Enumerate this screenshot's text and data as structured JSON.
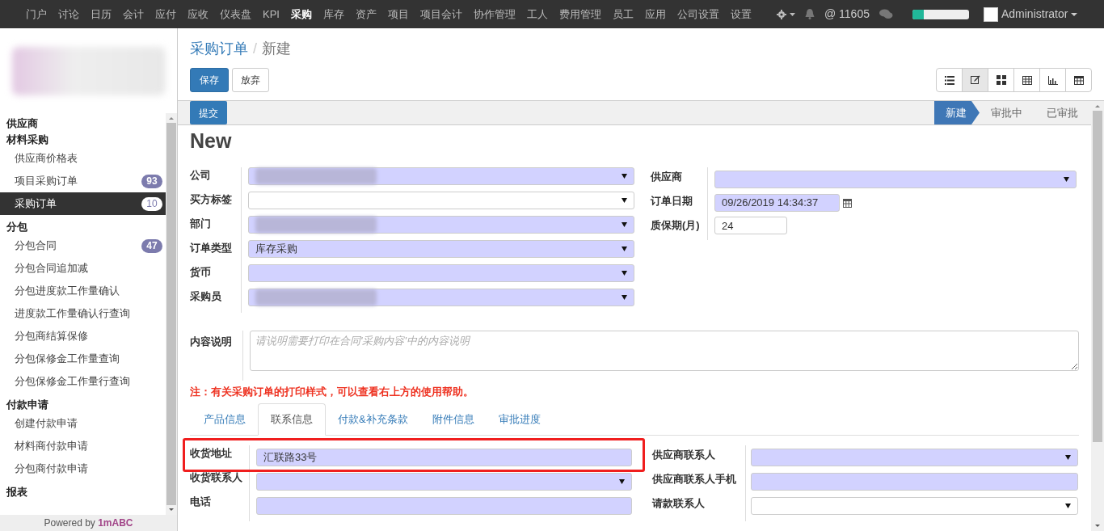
{
  "nav": {
    "items": [
      {
        "label": "门户",
        "selected": false
      },
      {
        "label": "讨论",
        "selected": false
      },
      {
        "label": "日历",
        "selected": false
      },
      {
        "label": "会计",
        "selected": false
      },
      {
        "label": "应付",
        "selected": false
      },
      {
        "label": "应收",
        "selected": false
      },
      {
        "label": "仪表盘",
        "selected": false
      },
      {
        "label": "KPI",
        "selected": false
      },
      {
        "label": "采购",
        "selected": true
      },
      {
        "label": "库存",
        "selected": false
      },
      {
        "label": "资产",
        "selected": false
      },
      {
        "label": "项目",
        "selected": false
      },
      {
        "label": "项目会计",
        "selected": false
      },
      {
        "label": "协作管理",
        "selected": false
      },
      {
        "label": "工人",
        "selected": false
      },
      {
        "label": "费用管理",
        "selected": false
      },
      {
        "label": "员工",
        "selected": false
      },
      {
        "label": "应用",
        "selected": false
      },
      {
        "label": "公司设置",
        "selected": false
      },
      {
        "label": "设置",
        "selected": false
      }
    ],
    "counter": "@ 11605",
    "progress": {
      "level": 0.2
    },
    "user": "Administrator"
  },
  "sidebar": {
    "sections": [
      {
        "title": "供应商"
      },
      {
        "title": "材料采购",
        "items": [
          {
            "label": "供应商价格表",
            "selected": false
          },
          {
            "label": "项目采购订单",
            "badge": "93",
            "selected": false
          },
          {
            "label": "采购订单",
            "badge": "10",
            "selected": true
          }
        ]
      },
      {
        "title": "分包",
        "items": [
          {
            "label": "分包合同",
            "badge": "47",
            "selected": false
          },
          {
            "label": "分包合同追加减",
            "selected": false
          },
          {
            "label": "分包进度款工作量确认",
            "selected": false
          },
          {
            "label": "进度款工作量确认行查询",
            "selected": false
          },
          {
            "label": "分包商结算保修",
            "selected": false
          },
          {
            "label": "分包保修金工作量查询",
            "selected": false
          },
          {
            "label": "分包保修金工作量行查询",
            "selected": false
          }
        ]
      },
      {
        "title": "付款申请",
        "items": [
          {
            "label": "创建付款申请",
            "selected": false
          },
          {
            "label": "材料商付款申请",
            "selected": false
          },
          {
            "label": "分包商付款申请",
            "selected": false
          }
        ]
      },
      {
        "title": "报表"
      }
    ],
    "footer": {
      "text": "Powered by",
      "brand": "1mABC"
    }
  },
  "breadcrumb": [
    "采购订单",
    "新建"
  ],
  "breadcrumb_separator": "/",
  "buttons": {
    "save": "保存",
    "discard": "放弃",
    "submit": "提交"
  },
  "views": [
    {
      "kind": "list",
      "selected": false
    },
    {
      "kind": "form",
      "selected": true
    },
    {
      "kind": "kanban",
      "selected": false
    },
    {
      "kind": "grid",
      "selected": false
    },
    {
      "kind": "graph",
      "selected": false
    },
    {
      "kind": "calendar",
      "selected": false
    }
  ],
  "stages": [
    {
      "label": "新建",
      "selected": true
    },
    {
      "label": "审批中",
      "selected": false
    },
    {
      "label": "已审批",
      "selected": false
    }
  ],
  "title": "New",
  "left_fields": [
    {
      "label": "公司",
      "kind": "select",
      "required": true,
      "blurred": true
    },
    {
      "label": "买方标签",
      "kind": "select",
      "required": false
    },
    {
      "label": "部门",
      "kind": "select",
      "required": true,
      "blurred": true
    },
    {
      "label": "订单类型",
      "kind": "select",
      "required": true,
      "value": "库存采购"
    },
    {
      "label": "货币",
      "kind": "select",
      "required": true
    },
    {
      "label": "采购员",
      "kind": "select",
      "required": true,
      "blurred": true
    }
  ],
  "right_fields": [
    {
      "label": "供应商",
      "kind": "select",
      "required": true
    },
    {
      "label": "订单日期",
      "kind": "date",
      "required": true,
      "value": "09/26/2019 14:34:37"
    },
    {
      "label": "质保期(月)",
      "kind": "text",
      "required": false,
      "value": "24"
    }
  ],
  "description": {
    "label": "内容说明",
    "placeholder": "请说明需要打印在合同'采购内容'中的内容说明"
  },
  "note": "注：有关采购订单的打印样式，可以查看右上方的使用帮助。",
  "tabs": [
    {
      "label": "产品信息",
      "selected": false
    },
    {
      "label": "联系信息",
      "selected": true
    },
    {
      "label": "付款&补充条款",
      "selected": false
    },
    {
      "label": "附件信息",
      "selected": false
    },
    {
      "label": "审批进度",
      "selected": false
    }
  ],
  "contact_left": [
    {
      "label": "收货地址",
      "kind": "text",
      "required": true,
      "value": "汇联路33号",
      "highlighted": true
    },
    {
      "label": "收货联系人",
      "kind": "select",
      "required": true
    },
    {
      "label": "电话",
      "kind": "text",
      "required": true
    }
  ],
  "contact_right": [
    {
      "label": "供应商联系人",
      "kind": "select",
      "required": true
    },
    {
      "label": "供应商联系人手机",
      "kind": "text",
      "required": true
    },
    {
      "label": "请款联系人",
      "kind": "select",
      "required": false
    }
  ]
}
